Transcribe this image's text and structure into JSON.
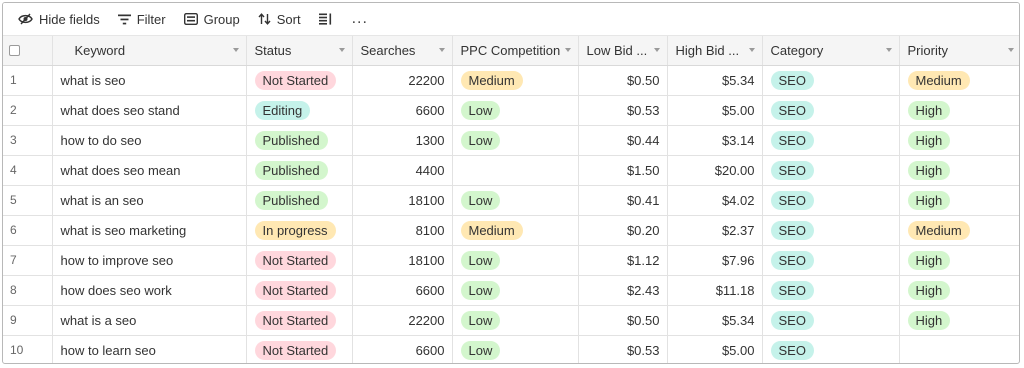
{
  "toolbar": {
    "hide_fields": "Hide fields",
    "filter": "Filter",
    "group": "Group",
    "sort": "Sort",
    "more": "..."
  },
  "colors": {
    "pink": "#ffd7dd",
    "teal": "#c5f2ea",
    "green": "#d3f6cd",
    "orange": "#ffe8b3"
  },
  "columns": [
    "Keyword",
    "Status",
    "Searches",
    "PPC Competition",
    "Low Bid ...",
    "High Bid ...",
    "Category",
    "Priority"
  ],
  "rows": [
    {
      "n": "1",
      "keyword": "what is seo",
      "status": "Not Started",
      "searches": "22200",
      "ppc": "Medium",
      "low": "$0.50",
      "high": "$5.34",
      "category": "SEO",
      "priority": "Medium"
    },
    {
      "n": "2",
      "keyword": "what does seo stand",
      "status": "Editing",
      "searches": "6600",
      "ppc": "Low",
      "low": "$0.53",
      "high": "$5.00",
      "category": "SEO",
      "priority": "High"
    },
    {
      "n": "3",
      "keyword": "how to do seo",
      "status": "Published",
      "searches": "1300",
      "ppc": "Low",
      "low": "$0.44",
      "high": "$3.14",
      "category": "SEO",
      "priority": "High"
    },
    {
      "n": "4",
      "keyword": "what does seo mean",
      "status": "Published",
      "searches": "4400",
      "ppc": "",
      "low": "$1.50",
      "high": "$20.00",
      "category": "SEO",
      "priority": "High"
    },
    {
      "n": "5",
      "keyword": "what is an seo",
      "status": "Published",
      "searches": "18100",
      "ppc": "Low",
      "low": "$0.41",
      "high": "$4.02",
      "category": "SEO",
      "priority": "High"
    },
    {
      "n": "6",
      "keyword": "what is seo marketing",
      "status": "In progress",
      "searches": "8100",
      "ppc": "Medium",
      "low": "$0.20",
      "high": "$2.37",
      "category": "SEO",
      "priority": "Medium"
    },
    {
      "n": "7",
      "keyword": "how to improve seo",
      "status": "Not Started",
      "searches": "18100",
      "ppc": "Low",
      "low": "$1.12",
      "high": "$7.96",
      "category": "SEO",
      "priority": "High"
    },
    {
      "n": "8",
      "keyword": "how does seo work",
      "status": "Not Started",
      "searches": "6600",
      "ppc": "Low",
      "low": "$2.43",
      "high": "$11.18",
      "category": "SEO",
      "priority": "High"
    },
    {
      "n": "9",
      "keyword": "what is a seo",
      "status": "Not Started",
      "searches": "22200",
      "ppc": "Low",
      "low": "$0.50",
      "high": "$5.34",
      "category": "SEO",
      "priority": "High"
    },
    {
      "n": "10",
      "keyword": "how to learn seo",
      "status": "Not Started",
      "searches": "6600",
      "ppc": "Low",
      "low": "$0.53",
      "high": "$5.00",
      "category": "SEO",
      "priority": ""
    }
  ]
}
